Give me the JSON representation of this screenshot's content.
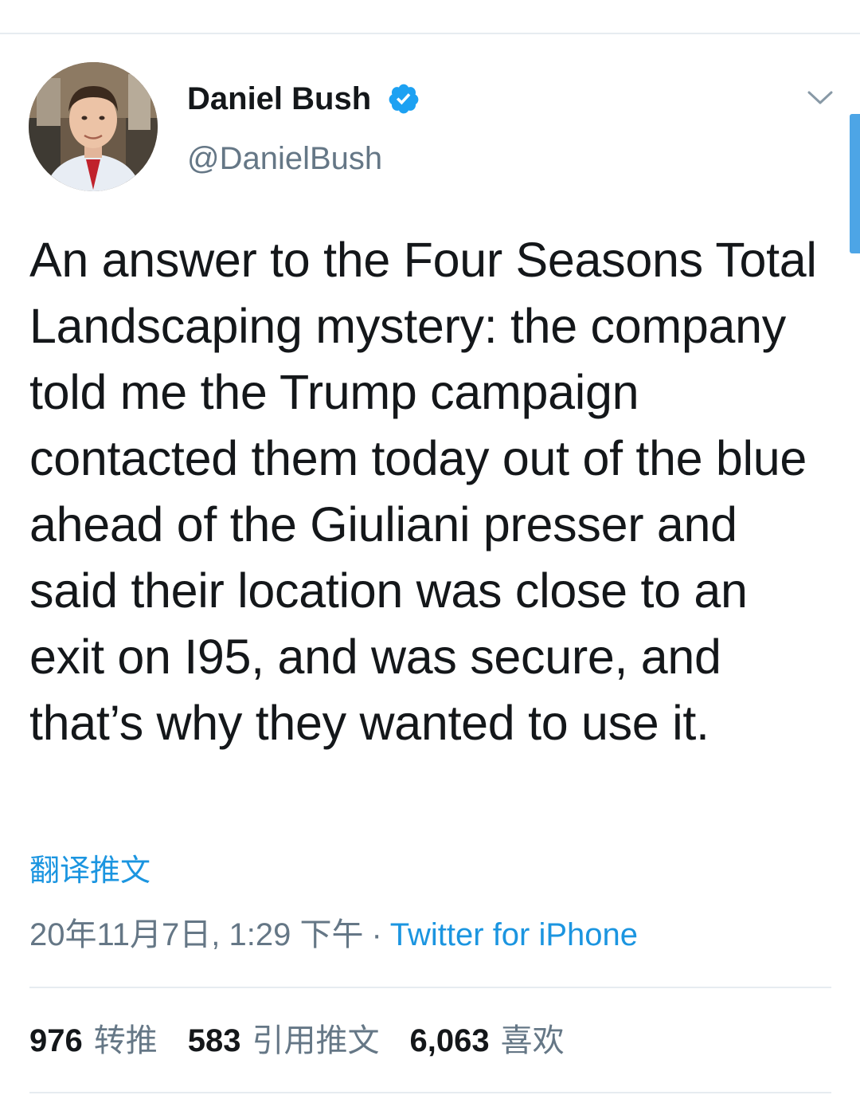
{
  "tweet": {
    "author": {
      "name": "Daniel Bush",
      "handle": "@DanielBush",
      "verified": true,
      "avatar_icon": "profile-photo"
    },
    "text": "An answer to the Four Seasons Total Landscaping mystery: the company told me the Trump campaign contacted them today out of the blue ahead of the Giuliani presser and said their location was close to an exit on I95, and was secure, and that’s why they wanted to use it.",
    "translate_label": "翻译推文",
    "timestamp": "20年11月7日, 1:29 下午",
    "separator": "·",
    "source": "Twitter for iPhone",
    "stats": {
      "retweets": {
        "count": "976",
        "label": "转推"
      },
      "quotes": {
        "count": "583",
        "label": "引用推文"
      },
      "likes": {
        "count": "6,063",
        "label": "喜欢"
      }
    }
  },
  "colors": {
    "accent": "#1b95e0",
    "secondary_text": "#657786",
    "verified": "#1da1f2",
    "divider": "#e6ecf0"
  },
  "icons": {
    "verified": "verified-badge-icon",
    "caret": "chevron-down-icon"
  }
}
